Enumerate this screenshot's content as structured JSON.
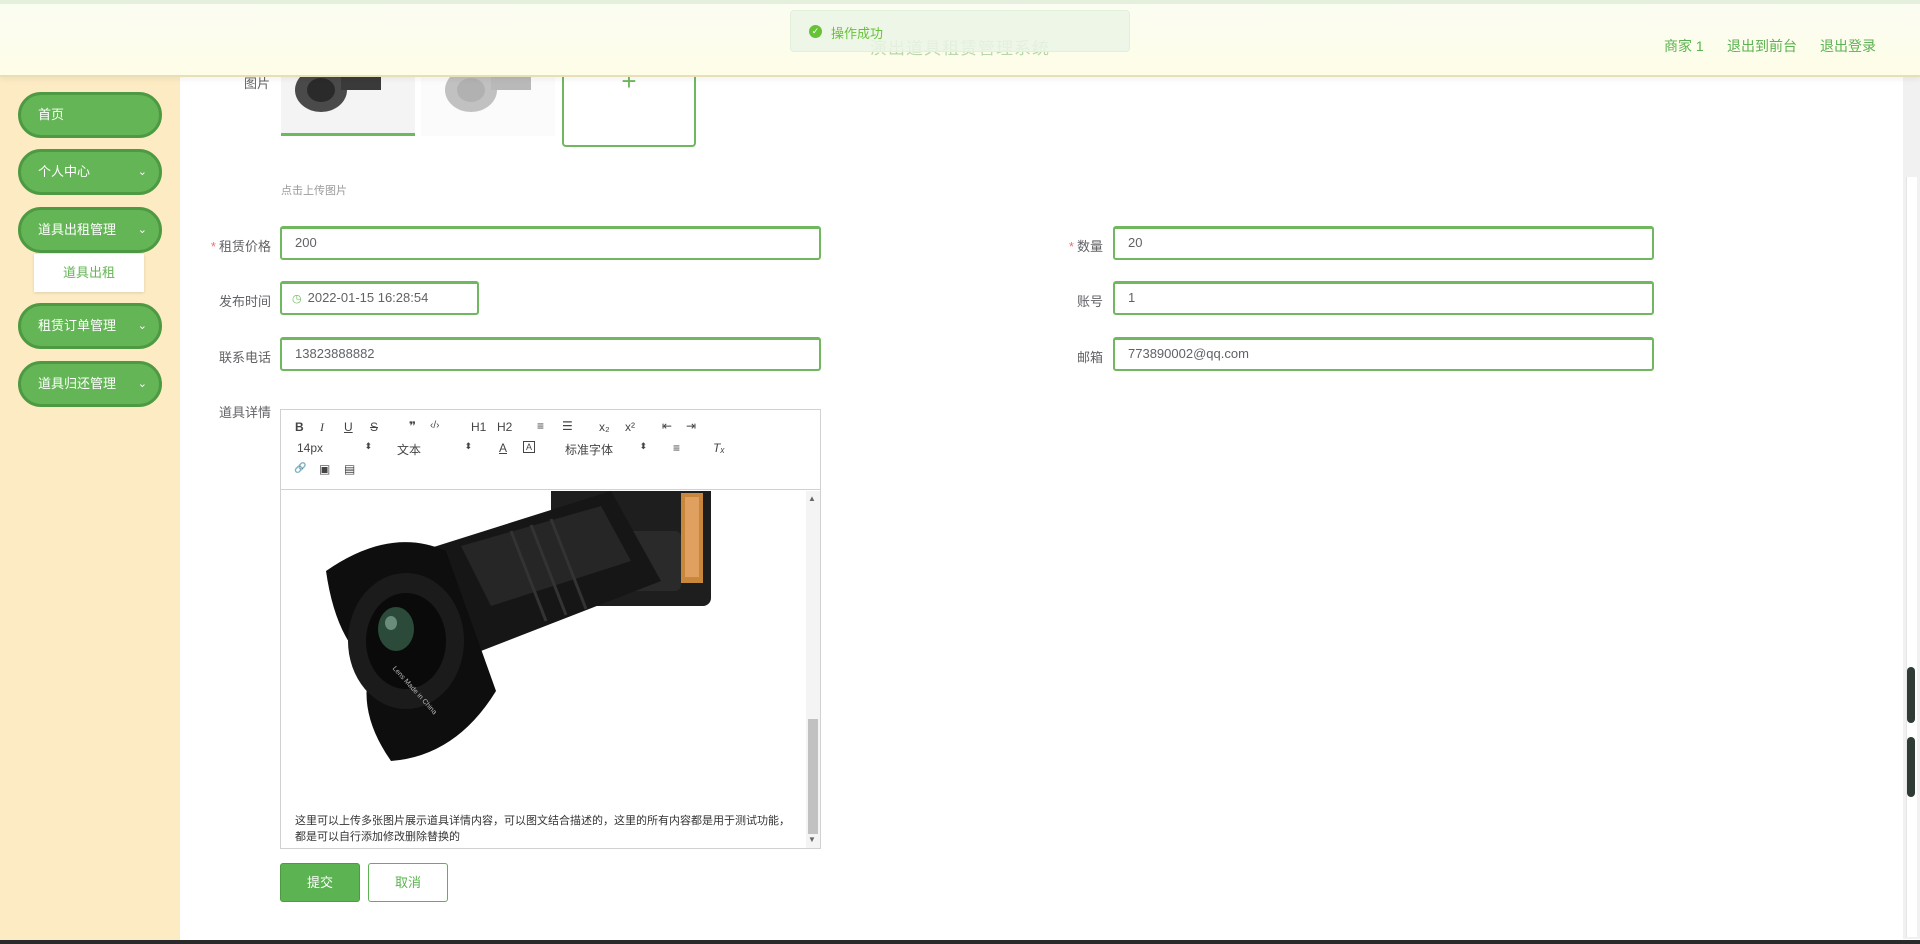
{
  "header": {
    "app_title": "演出道具租赁管理系统",
    "toast": "操作成功",
    "user_label": "商家 1",
    "front_link": "退出到前台",
    "logout_link": "退出登录"
  },
  "sidebar": {
    "items": [
      {
        "label": "首页"
      },
      {
        "label": "个人中心"
      },
      {
        "label": "道具出租管理"
      },
      {
        "label": "租赁订单管理"
      },
      {
        "label": "道具归还管理"
      }
    ],
    "sub_item": "道具出租"
  },
  "form": {
    "image_label": "图片",
    "upload_hint": "点击上传图片",
    "price_label": "租赁价格",
    "price_value": "200",
    "quantity_label": "数量",
    "quantity_value": "20",
    "publish_time_label": "发布时间",
    "publish_time_value": "2022-01-15 16:28:54",
    "account_label": "账号",
    "account_value": "1",
    "phone_label": "联系电话",
    "phone_value": "13823888882",
    "email_label": "邮箱",
    "email_value": "773890002@qq.com",
    "details_label": "道具详情",
    "details_text": "这里可以上传多张图片展示道具详情内容，可以图文结合描述的，这里的所有内容都是用于测试功能，都是可以自行添加修改删除替换的",
    "camera_markings": [
      "Lens Made in China"
    ],
    "submit_label": "提交",
    "cancel_label": "取消"
  },
  "editor_toolbar": {
    "font_size": "14px",
    "text_style": "文本",
    "font_family": "标准字体",
    "h1": "H1",
    "h2": "H2"
  },
  "colors": {
    "accent": "#63b555",
    "sidebar_bg": "#fdebc4",
    "header_bg": "#fefde8",
    "required": "#f56c6c"
  },
  "icons": {
    "bold": "B",
    "italic": "I",
    "underline": "U",
    "strike": "S",
    "blockquote": "❞",
    "code": "‹/›",
    "ordered_list": "≡",
    "bullet_list": "☰",
    "subscript": "x₂",
    "superscript": "x²",
    "outdent": "⇤",
    "indent": "⇥",
    "font_color": "A",
    "bg_color": "A",
    "align": "≡",
    "clear_format": "Tₓ",
    "link": "🔗",
    "image": "▣",
    "video": "▤",
    "plus": "+",
    "clock": "◷",
    "check": "✓",
    "chevron": "⌄"
  }
}
